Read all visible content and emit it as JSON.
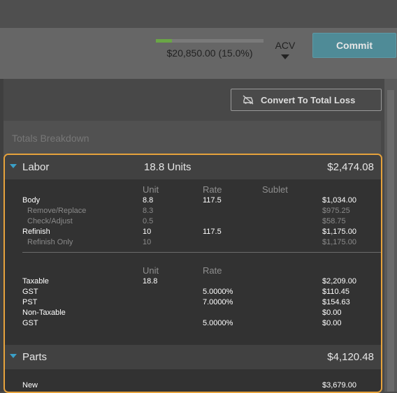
{
  "header": {
    "progress_fraction": 0.15,
    "progress_text": "$20,850.00 (15.0%)",
    "acv_label": "ACV",
    "commit_label": "Commit",
    "progress_color": "#6aa646",
    "commit_color": "#4f8b97"
  },
  "toolbar": {
    "convert_label": "Convert To Total Loss",
    "convert_icon": "car-crash-icon"
  },
  "totals": {
    "title": "Totals Breakdown"
  },
  "labor": {
    "title": "Labor",
    "units": "18.8 Units",
    "total": "$2,474.08",
    "columns": {
      "unit": "Unit",
      "rate": "Rate",
      "sublet": "Sublet"
    },
    "rows": [
      {
        "label": "Body",
        "unit": "8.8",
        "rate": "117.5",
        "amount": "$1,034.00"
      },
      {
        "label": "Remove/Replace",
        "unit": "8.3",
        "rate": "",
        "amount": "$975.25"
      },
      {
        "label": "Check/Adjust",
        "unit": "0.5",
        "rate": "",
        "amount": "$58.75"
      },
      {
        "label": "Refinish",
        "unit": "10",
        "rate": "117.5",
        "amount": "$1,175.00"
      },
      {
        "label": "Refinish Only",
        "unit": "10",
        "rate": "",
        "amount": "$1,175.00"
      }
    ],
    "tax_columns": {
      "unit": "Unit",
      "rate": "Rate"
    },
    "tax_rows": [
      {
        "label": "Taxable",
        "unit": "18.8",
        "rate": "",
        "amount": "$2,209.00"
      },
      {
        "label": "GST",
        "unit": "",
        "rate": "5.0000%",
        "amount": "$110.45"
      },
      {
        "label": "PST",
        "unit": "",
        "rate": "7.0000%",
        "amount": "$154.63"
      },
      {
        "label": "Non-Taxable",
        "unit": "",
        "rate": "",
        "amount": "$0.00"
      },
      {
        "label": "GST",
        "unit": "",
        "rate": "5.0000%",
        "amount": "$0.00"
      }
    ]
  },
  "parts": {
    "title": "Parts",
    "total": "$4,120.48",
    "rows": [
      {
        "label": "New",
        "amount": "$3,679.00"
      }
    ]
  },
  "colors": {
    "highlight_border": "#e6a23c",
    "section_triangle": "#3aa0c8"
  }
}
